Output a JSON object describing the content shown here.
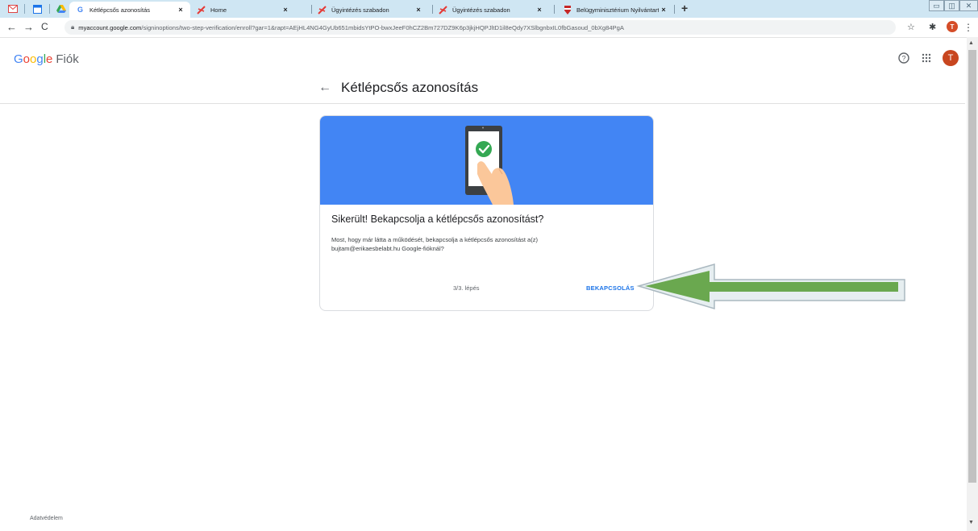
{
  "browser": {
    "tabs": [
      {
        "title": "Kétlépcsős azonosítás",
        "close": "×",
        "favicon": "G",
        "active": true
      },
      {
        "title": "Home",
        "close": "×"
      },
      {
        "title": "Ügyintézés szabadon",
        "close": "×"
      },
      {
        "title": "Ügyintézés szabadon",
        "close": "×"
      },
      {
        "title": "Belügyminisztérium Nyilvántartá",
        "close": "×"
      }
    ],
    "new_tab": "+",
    "url_host": "myaccount.google.com",
    "url_path": "/signinoptions/two-step-verification/enroll?gar=1&rapt=AEjHL4NG4GyUb651mbidsYtPO-bwxJeeF0hCZ2Bm727DZ9K6p3jkjHQPJltD1il8eQdy7XSlbgnbxIL0fbGasoud_0bXg84PgA",
    "profile_initial": "T"
  },
  "header": {
    "brand_google": [
      "G",
      "o",
      "o",
      "g",
      "l",
      "e"
    ],
    "brand_suffix": "Fiók",
    "avatar_initial": "T"
  },
  "page": {
    "title": "Kétlépcsős azonosítás"
  },
  "card": {
    "heading": "Sikerült! Bekapcsolja a kétlépcsős azonosítást?",
    "body_line1": "Most, hogy már látta a működését, bekapcsolja a kétlépcsős azonosítást a(z)",
    "body_line2": "bujtam@erikaesbelabt.hu Google-fióknál?",
    "step": "3/3. lépés",
    "enable_button": "BEKAPCSOLÁS"
  },
  "footer": {
    "privacy": "Adatvédelem"
  },
  "colors": {
    "accent": "#1a73e8",
    "hero": "#4285f4",
    "arrow": "#6aa84f"
  }
}
